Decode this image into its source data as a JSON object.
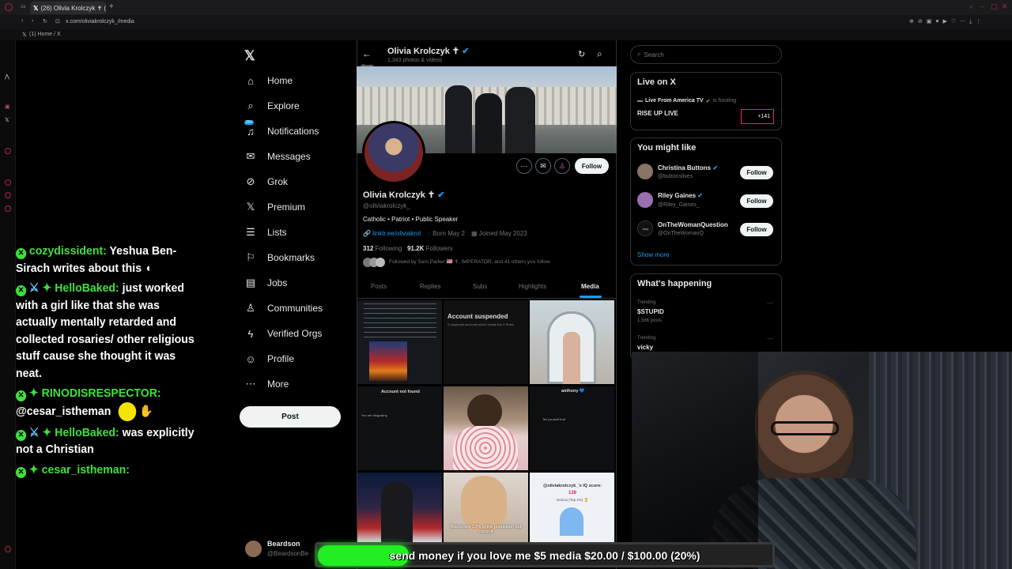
{
  "browser": {
    "tab_title": "(26) Olivia Krolczyk ✝ (@",
    "url": "x.com/oliviakrolczyk_/media",
    "bookmark": "(1) Home / X"
  },
  "chat": [
    {
      "user": "cozydissident:",
      "text": "Yeshua Ben-Sirach writes about this"
    },
    {
      "user": "HelloBaked:",
      "text": "just worked with a girl like that she was actually mentally retarded and collected rosaries/ other religious stuff cause she thought it was neat."
    },
    {
      "user": "RINODISRESPECTOR:",
      "text": "@cesar_istheman"
    },
    {
      "user": "HelloBaked:",
      "text": "was explicitly not a Christian"
    },
    {
      "user": "cesar_istheman:",
      "text": ""
    }
  ],
  "nav": {
    "items": [
      "Home",
      "Explore",
      "Notifications",
      "Messages",
      "Grok",
      "Premium",
      "Lists",
      "Bookmarks",
      "Jobs",
      "Communities",
      "Verified Orgs",
      "Profile",
      "More"
    ],
    "notif_badge": "20+",
    "post_label": "Post",
    "account_name": "Beardson",
    "account_handle": "@BeardsonBe"
  },
  "profile": {
    "header_name": "Olivia Krolczyk ✝",
    "header_count": "1,343 photos & videos",
    "back_tooltip": "Back",
    "name": "Olivia Krolczyk ✝",
    "handle": "@oliviakrolczyk_",
    "bio": "Catholic • Patriot • Public Speaker",
    "link": "linktr.ee/oliviakrol",
    "born": "Born May 2",
    "joined": "Joined May 2023",
    "following_count": "312",
    "following_label": "Following",
    "followers_count": "91.2K",
    "followers_label": "Followers",
    "followed_by": "Followed by Sam Parker 🇺🇸 ✝, IMPERATOR, and 41 others you follow",
    "follow_label": "Follow",
    "tabs": [
      "Posts",
      "Replies",
      "Subs",
      "Highlights",
      "Media"
    ],
    "active_tab": "Media"
  },
  "media": {
    "suspended_title": "Account suspended",
    "suspended_sub": "X suspends accounts which violate the X Rules.",
    "notfound_title": "Account not found",
    "notfound_sub": "You are disgusting",
    "anthony_name": "anthony 💙",
    "anthony_sub": "Tell yourself that",
    "iq_title": "@oliviakrolczyk_'s IQ score:",
    "iq_score": "139",
    "iq_genius": "Genius (Top 2%) 🏆",
    "blacks_caption": "Blacks are 13% of the population but commit"
  },
  "right": {
    "search_placeholder": "Search",
    "live_title": "Live on X",
    "live_host": "Live From America TV",
    "live_hosting": "is hosting",
    "live_show": "RISE UP LIVE",
    "live_count": "+141",
    "wtf_title": "You might like",
    "suggestions": [
      {
        "name": "Christina Buttons",
        "handle": "@buttonslives"
      },
      {
        "name": "Riley Gaines",
        "handle": "@Riley_Gaines_"
      },
      {
        "name": "OnTheWomanQuestion",
        "handle": "@OnTheWomanQ"
      }
    ],
    "follow_label": "Follow",
    "show_more": "Show more",
    "happening_title": "What's happening",
    "trends": [
      {
        "label": "Trending",
        "title": "$STUPID",
        "count": "1,566 posts"
      },
      {
        "label": "Trending",
        "title": "vicky",
        "count": ""
      }
    ]
  },
  "goal": {
    "text": "send money if you love me $5 media $20.00 / $100.00 (20%)",
    "progress": 0.2
  },
  "colors": {
    "accent": "#1d9bf0",
    "goal_green": "#22ee22",
    "chat_green": "#3de13b"
  }
}
